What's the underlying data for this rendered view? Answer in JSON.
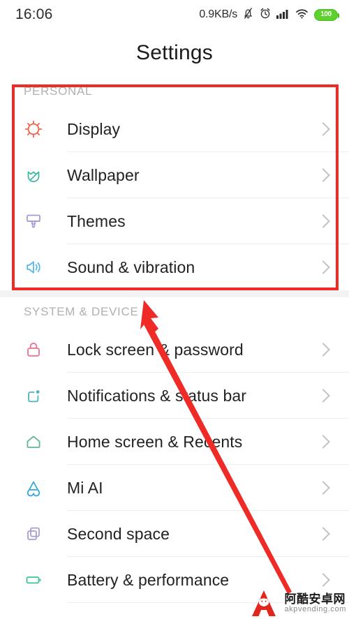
{
  "status_bar": {
    "clock": "16:06",
    "network_speed": "0.9KB/s",
    "icons": [
      "bell-mute-icon",
      "alarm-clock-icon",
      "signal-bars-icon",
      "wifi-icon"
    ],
    "battery_level": "100",
    "battery_color": "#5fd12e"
  },
  "header": {
    "title": "Settings"
  },
  "sections": [
    {
      "header": "PERSONAL",
      "rows": [
        {
          "label": "Display",
          "icon": "sun-icon",
          "color": "#f06449"
        },
        {
          "label": "Wallpaper",
          "icon": "flower-icon",
          "color": "#45b8a4"
        },
        {
          "label": "Themes",
          "icon": "paintbrush-icon",
          "color": "#a99ad8"
        },
        {
          "label": "Sound & vibration",
          "icon": "speaker-icon",
          "color": "#56b8ea"
        }
      ]
    },
    {
      "header": "SYSTEM & DEVICE",
      "rows": [
        {
          "label": "Lock screen & password",
          "icon": "lock-icon",
          "color": "#ef6f8e"
        },
        {
          "label": "Notifications & status bar",
          "icon": "notification-icon",
          "color": "#4db6bd"
        },
        {
          "label": "Home screen & Recents",
          "icon": "home-icon",
          "color": "#5cba8f"
        },
        {
          "label": "Mi AI",
          "icon": "mi-ai-icon",
          "color": "#3aa6e6"
        },
        {
          "label": "Second space",
          "icon": "second-space-icon",
          "color": "#a99ad8"
        },
        {
          "label": "Battery & performance",
          "icon": "battery-icon",
          "color": "#3fc39a"
        }
      ]
    }
  ],
  "annotations": {
    "highlight_color": "#ee2b26",
    "arrow_color": "#ee2b26"
  },
  "watermark": {
    "chinese": "阿酷安卓网",
    "url": "akpvending.com",
    "logo_color": "#e1261c"
  }
}
